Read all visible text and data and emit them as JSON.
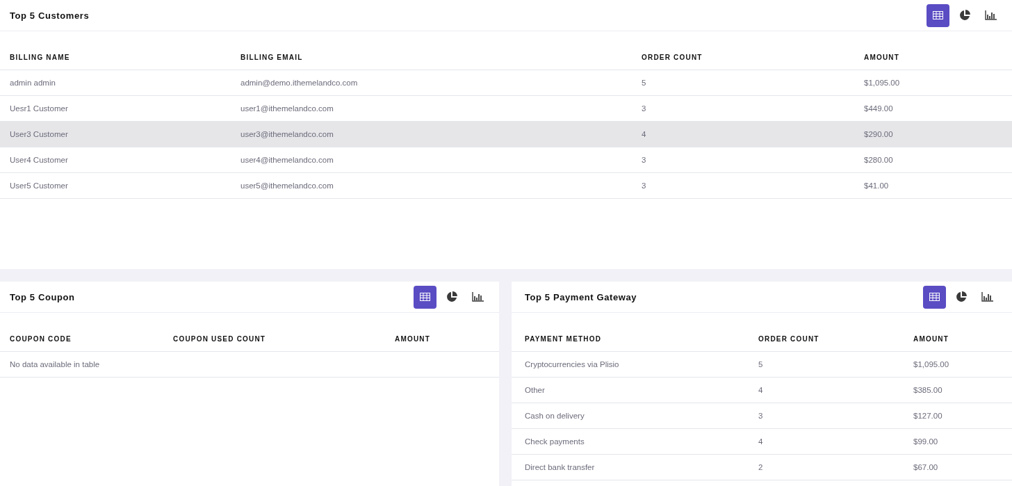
{
  "panels": [
    {
      "title": "Top 5 Customers",
      "views": [
        {
          "kind": "table",
          "selected": true
        },
        {
          "kind": "pie",
          "selected": false
        },
        {
          "kind": "bar",
          "selected": false
        }
      ],
      "columns": [
        "BILLING NAME",
        "BILLING EMAIL",
        "ORDER COUNT",
        "AMOUNT"
      ],
      "rows": [
        {
          "cells": [
            "admin admin",
            "admin@demo.ithemelandco.com",
            "5",
            "$1,095.00"
          ],
          "highlighted": false
        },
        {
          "cells": [
            "Uesr1 Customer",
            "user1@ithemelandco.com",
            "3",
            "$449.00"
          ],
          "highlighted": false
        },
        {
          "cells": [
            "User3 Customer",
            "user3@ithemelandco.com",
            "4",
            "$290.00"
          ],
          "highlighted": true
        },
        {
          "cells": [
            "User4 Customer",
            "user4@ithemelandco.com",
            "3",
            "$280.00"
          ],
          "highlighted": false
        },
        {
          "cells": [
            "User5 Customer",
            "user5@ithemelandco.com",
            "3",
            "$41.00"
          ],
          "highlighted": false
        }
      ]
    },
    {
      "title": "Top 5 Coupon",
      "views": [
        {
          "kind": "table",
          "selected": true
        },
        {
          "kind": "pie",
          "selected": false
        },
        {
          "kind": "bar",
          "selected": false
        }
      ],
      "columns": [
        "COUPON CODE",
        "COUPON USED COUNT",
        "AMOUNT"
      ],
      "empty_message": "No data available in table"
    },
    {
      "title": "Top 5 Payment Gateway",
      "views": [
        {
          "kind": "table",
          "selected": true
        },
        {
          "kind": "pie",
          "selected": false
        },
        {
          "kind": "bar",
          "selected": false
        }
      ],
      "columns": [
        "PAYMENT METHOD",
        "ORDER COUNT",
        "AMOUNT"
      ],
      "rows": [
        {
          "cells": [
            "Cryptocurrencies via Plisio",
            "5",
            "$1,095.00"
          ],
          "highlighted": false
        },
        {
          "cells": [
            "Other",
            "4",
            "$385.00"
          ],
          "highlighted": false
        },
        {
          "cells": [
            "Cash on delivery",
            "3",
            "$127.00"
          ],
          "highlighted": false
        },
        {
          "cells": [
            "Check payments",
            "4",
            "$99.00"
          ],
          "highlighted": false
        },
        {
          "cells": [
            "Direct bank transfer",
            "2",
            "$67.00"
          ],
          "highlighted": false
        }
      ]
    }
  ]
}
